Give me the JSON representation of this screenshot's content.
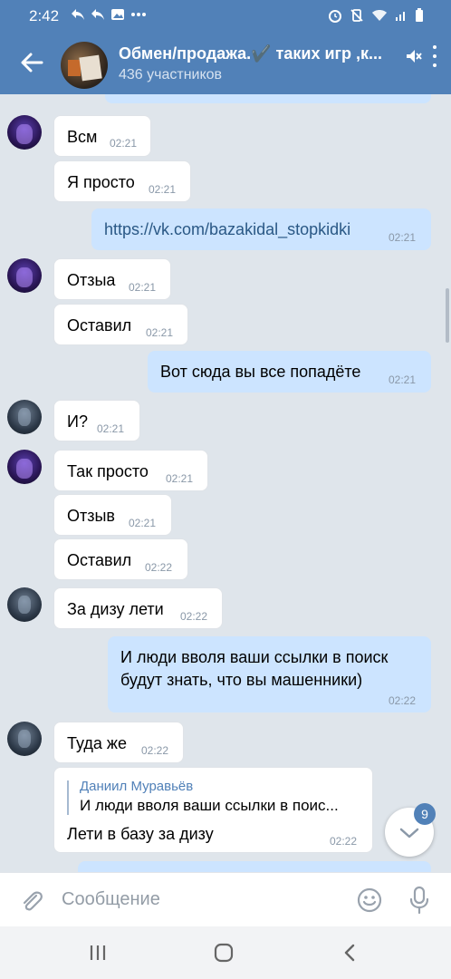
{
  "status_bar": {
    "time": "2:42"
  },
  "header": {
    "title": "Обмен/продажа.✔️ таких игр ,к...",
    "subtitle": "436 участников"
  },
  "messages": [
    {
      "dir": "in",
      "text": "Всм",
      "time": "02:21"
    },
    {
      "dir": "in",
      "text": "Я просто",
      "time": "02:21"
    },
    {
      "dir": "out",
      "text": "https://vk.com/bazakidal_stopkidki",
      "time": "02:21"
    },
    {
      "dir": "in",
      "text": "Отзыа",
      "time": "02:21"
    },
    {
      "dir": "in",
      "text": "Оставил",
      "time": "02:21"
    },
    {
      "dir": "out",
      "text": "Вот сюда вы все попадёте",
      "time": "02:21"
    },
    {
      "dir": "in",
      "text": "И?",
      "time": "02:21"
    },
    {
      "dir": "in",
      "text": "Так просто",
      "time": "02:21"
    },
    {
      "dir": "in",
      "text": "Отзыв",
      "time": "02:21"
    },
    {
      "dir": "in",
      "text": "Оставил",
      "time": "02:22"
    },
    {
      "dir": "in",
      "text": "За дизу лети",
      "time": "02:22"
    },
    {
      "dir": "out",
      "text_line1": "И люди вволя ваши ссылки в поиск",
      "text_line2": "будут знать, что вы машенники)",
      "time": "02:22"
    },
    {
      "dir": "in",
      "text": "Туда же",
      "time": "02:22"
    },
    {
      "dir": "in",
      "reply_author": "Даниил Муравьёв",
      "reply_text": "И люди вволя ваши ссылки в поис...",
      "text": "Лети в базу за дизу",
      "time": "02:22"
    }
  ],
  "scroll_button": {
    "unread_count": "9"
  },
  "composer": {
    "placeholder": "Сообщение"
  },
  "icons": {
    "back": "arrow-left-icon",
    "mute": "muted-bell-icon",
    "menu": "more-vertical-icon",
    "attach": "paperclip-icon",
    "emoji": "smiley-icon",
    "voice": "microphone-icon",
    "scroll_down": "chevron-down-icon"
  },
  "colors": {
    "header": "#5181b8",
    "incoming": "#ffffff",
    "outgoing": "#cce4ff",
    "background": "#dfe5eb"
  }
}
